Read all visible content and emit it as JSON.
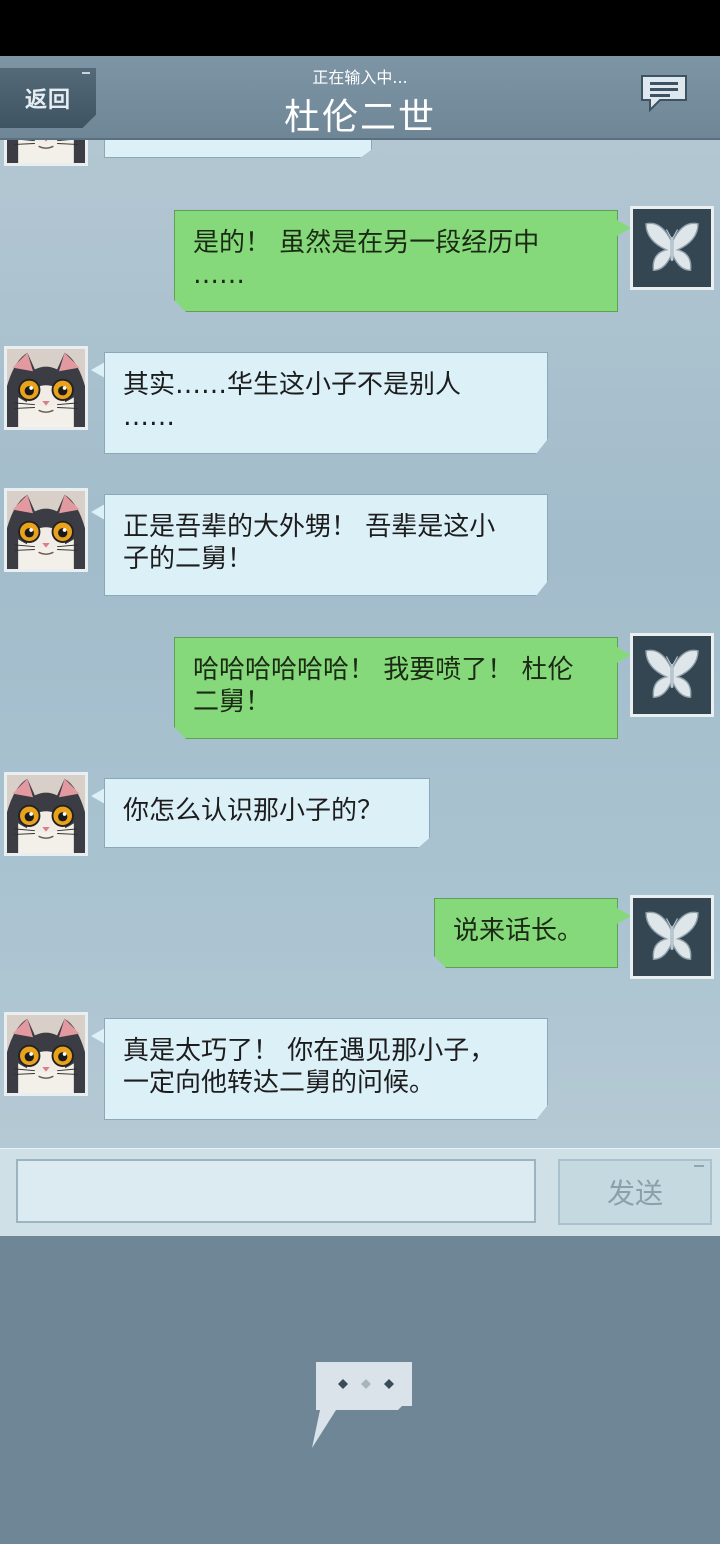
{
  "header": {
    "back_label": "返回",
    "typing_status": "正在输入中...",
    "contact_name": "杜伦二世"
  },
  "messages": [
    {
      "sender": "contact",
      "text": ""
    },
    {
      "sender": "me",
      "lines": [
        "是的！ 虽然是在另一段经历中",
        "……"
      ]
    },
    {
      "sender": "contact",
      "lines": [
        "其实……华生这小子不是别人",
        "……"
      ]
    },
    {
      "sender": "contact",
      "lines": [
        "正是吾辈的大外甥！ 吾辈是这小",
        "子的二舅！"
      ]
    },
    {
      "sender": "me",
      "lines": [
        "哈哈哈哈哈哈！ 我要喷了！ 杜伦",
        "二舅！"
      ]
    },
    {
      "sender": "contact",
      "lines": [
        "你怎么认识那小子的？"
      ]
    },
    {
      "sender": "me",
      "lines": [
        "说来话长。"
      ]
    },
    {
      "sender": "contact",
      "lines": [
        "真是太巧了！ 你在遇见那小子，",
        "一定向他转达二舅的问候。"
      ]
    }
  ],
  "input": {
    "placeholder": "",
    "send_label": "发送"
  },
  "icons": {
    "contact_avatar": "cat-avatar-icon",
    "my_avatar": "butterfly-avatar-icon",
    "chat_list": "chat-bubbles-icon",
    "more": "more-dots-icon"
  },
  "colors": {
    "contact_bubble": "#dcf0f8",
    "my_bubble": "#86d97a",
    "header": "#7d95a5"
  }
}
